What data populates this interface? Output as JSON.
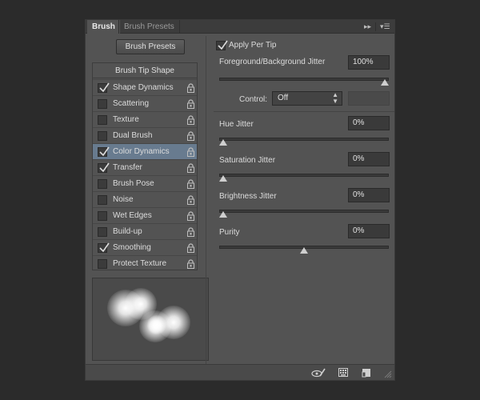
{
  "tabs": [
    {
      "label": "Brush",
      "active": true
    },
    {
      "label": "Brush Presets",
      "active": false
    }
  ],
  "panel_controls": {
    "forward": "▸▸",
    "menu": "▾☰"
  },
  "brush_presets_button": "Brush Presets",
  "brush_tip_shape": "Brush Tip Shape",
  "options": [
    {
      "label": "Shape Dynamics",
      "checked": true,
      "selected": false
    },
    {
      "label": "Scattering",
      "checked": false,
      "selected": false
    },
    {
      "label": "Texture",
      "checked": false,
      "selected": false
    },
    {
      "label": "Dual Brush",
      "checked": false,
      "selected": false
    },
    {
      "label": "Color Dynamics",
      "checked": true,
      "selected": true
    },
    {
      "label": "Transfer",
      "checked": true,
      "selected": false
    },
    {
      "label": "Brush Pose",
      "checked": false,
      "selected": false
    },
    {
      "label": "Noise",
      "checked": false,
      "selected": false
    },
    {
      "label": "Wet Edges",
      "checked": false,
      "selected": false
    },
    {
      "label": "Build-up",
      "checked": false,
      "selected": false
    },
    {
      "label": "Smoothing",
      "checked": true,
      "selected": false
    },
    {
      "label": "Protect Texture",
      "checked": false,
      "selected": false
    }
  ],
  "apply_per_tip": {
    "label": "Apply Per Tip",
    "checked": true
  },
  "fg_bg_jitter": {
    "label": "Foreground/Background Jitter",
    "value": "100%",
    "slider": 1.0
  },
  "control": {
    "label": "Control:",
    "value": "Off"
  },
  "hue_jitter": {
    "label": "Hue Jitter",
    "value": "0%",
    "slider": 0.0
  },
  "saturation_jitter": {
    "label": "Saturation Jitter",
    "value": "0%",
    "slider": 0.0
  },
  "brightness_jitter": {
    "label": "Brightness Jitter",
    "value": "0%",
    "slider": 0.0
  },
  "purity": {
    "label": "Purity",
    "value": "0%",
    "slider": 0.5
  },
  "footer_icons": [
    "eye-brush-icon",
    "grid-panel-icon",
    "new-preset-icon",
    "resize-grip-icon"
  ],
  "colors": {
    "selected_row": "#687b8f",
    "panel": "#535353",
    "background": "#2b2b2b"
  }
}
